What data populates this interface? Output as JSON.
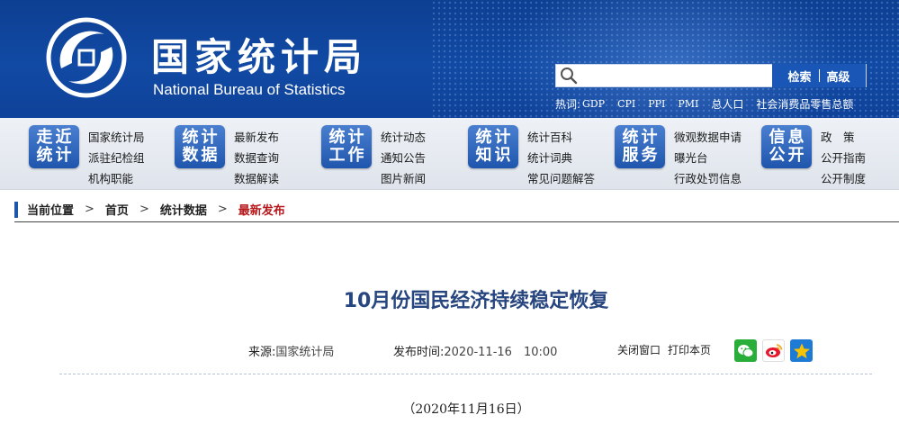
{
  "header": {
    "title_cn": "国家统计局",
    "title_en": "National Bureau of Statistics",
    "search": {
      "placeholder": "",
      "search_label": "检索",
      "advanced_label": "高级"
    },
    "hotwords_label": "热词:",
    "hotwords": [
      "GDP",
      "CPI",
      "PPI",
      "PMI",
      "总人口",
      "社会消费品零售总额"
    ]
  },
  "nav": [
    {
      "badge": [
        "走近",
        "统计"
      ],
      "links": [
        "国家统计局",
        "派驻纪检组",
        "机构职能"
      ]
    },
    {
      "badge": [
        "统计",
        "数据"
      ],
      "links": [
        "最新发布",
        "数据查询",
        "数据解读"
      ]
    },
    {
      "badge": [
        "统计",
        "工作"
      ],
      "links": [
        "统计动态",
        "通知公告",
        "图片新闻"
      ]
    },
    {
      "badge": [
        "统计",
        "知识"
      ],
      "links": [
        "统计百科",
        "统计词典",
        "常见问题解答"
      ]
    },
    {
      "badge": [
        "统计",
        "服务"
      ],
      "links": [
        "微观数据申请",
        "曝光台",
        "行政处罚信息"
      ]
    },
    {
      "badge": [
        "信息",
        "公开"
      ],
      "links": [
        "政　策",
        "公开指南",
        "公开制度"
      ]
    }
  ],
  "breadcrumb": {
    "label": "当前位置",
    "items": [
      "首页",
      "统计数据",
      "最新发布"
    ],
    "separator": ">"
  },
  "article": {
    "title": "10月份国民经济持续稳定恢复",
    "source_label": "来源:",
    "source_value": "国家统计局",
    "published_label": "发布时间:",
    "published_value": "2020-11-16　10:00",
    "close_label": "关闭窗口",
    "print_label": "打印本页",
    "date_line": "（2020年11月16日）"
  },
  "colors": {
    "header_blue": "#114aa4",
    "badge_blue": "#1f56ad",
    "title_blue": "#27467f",
    "current_crumb_red": "#b7181c",
    "wechat_green": "#2aae3a",
    "weibo_orange": "#f5a623",
    "qzone_yellow": "#f7c300"
  },
  "icons": [
    "nbs-logo-icon",
    "search-icon",
    "chevron-right-icon",
    "wechat-icon",
    "weibo-icon",
    "qzone-star-icon"
  ]
}
